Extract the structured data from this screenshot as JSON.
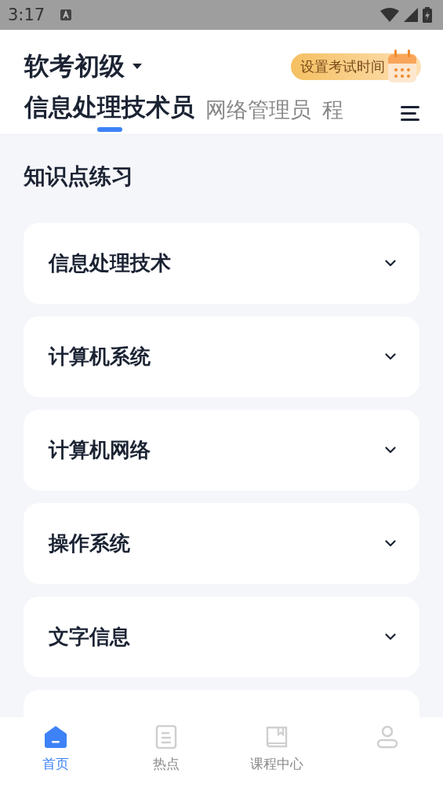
{
  "status_bar": {
    "time": "3:17"
  },
  "header": {
    "title": "软考初级",
    "exam_time_button": "设置考试时间"
  },
  "tabs": [
    {
      "label": "信息处理技术员",
      "selected": true
    },
    {
      "label": "网络管理员",
      "selected": false
    },
    {
      "label": "程",
      "selected": false
    }
  ],
  "section": {
    "title": "知识点练习"
  },
  "topics": [
    {
      "label": "信息处理技术"
    },
    {
      "label": "计算机系统"
    },
    {
      "label": "计算机网络"
    },
    {
      "label": "操作系统"
    },
    {
      "label": "文字信息"
    }
  ],
  "bottom_nav": [
    {
      "kind": "home",
      "label": "首页",
      "selected": true
    },
    {
      "kind": "hot",
      "label": "热点",
      "selected": false
    },
    {
      "kind": "course",
      "label": "课程中心",
      "selected": false
    },
    {
      "kind": "profile",
      "selected": false
    }
  ]
}
